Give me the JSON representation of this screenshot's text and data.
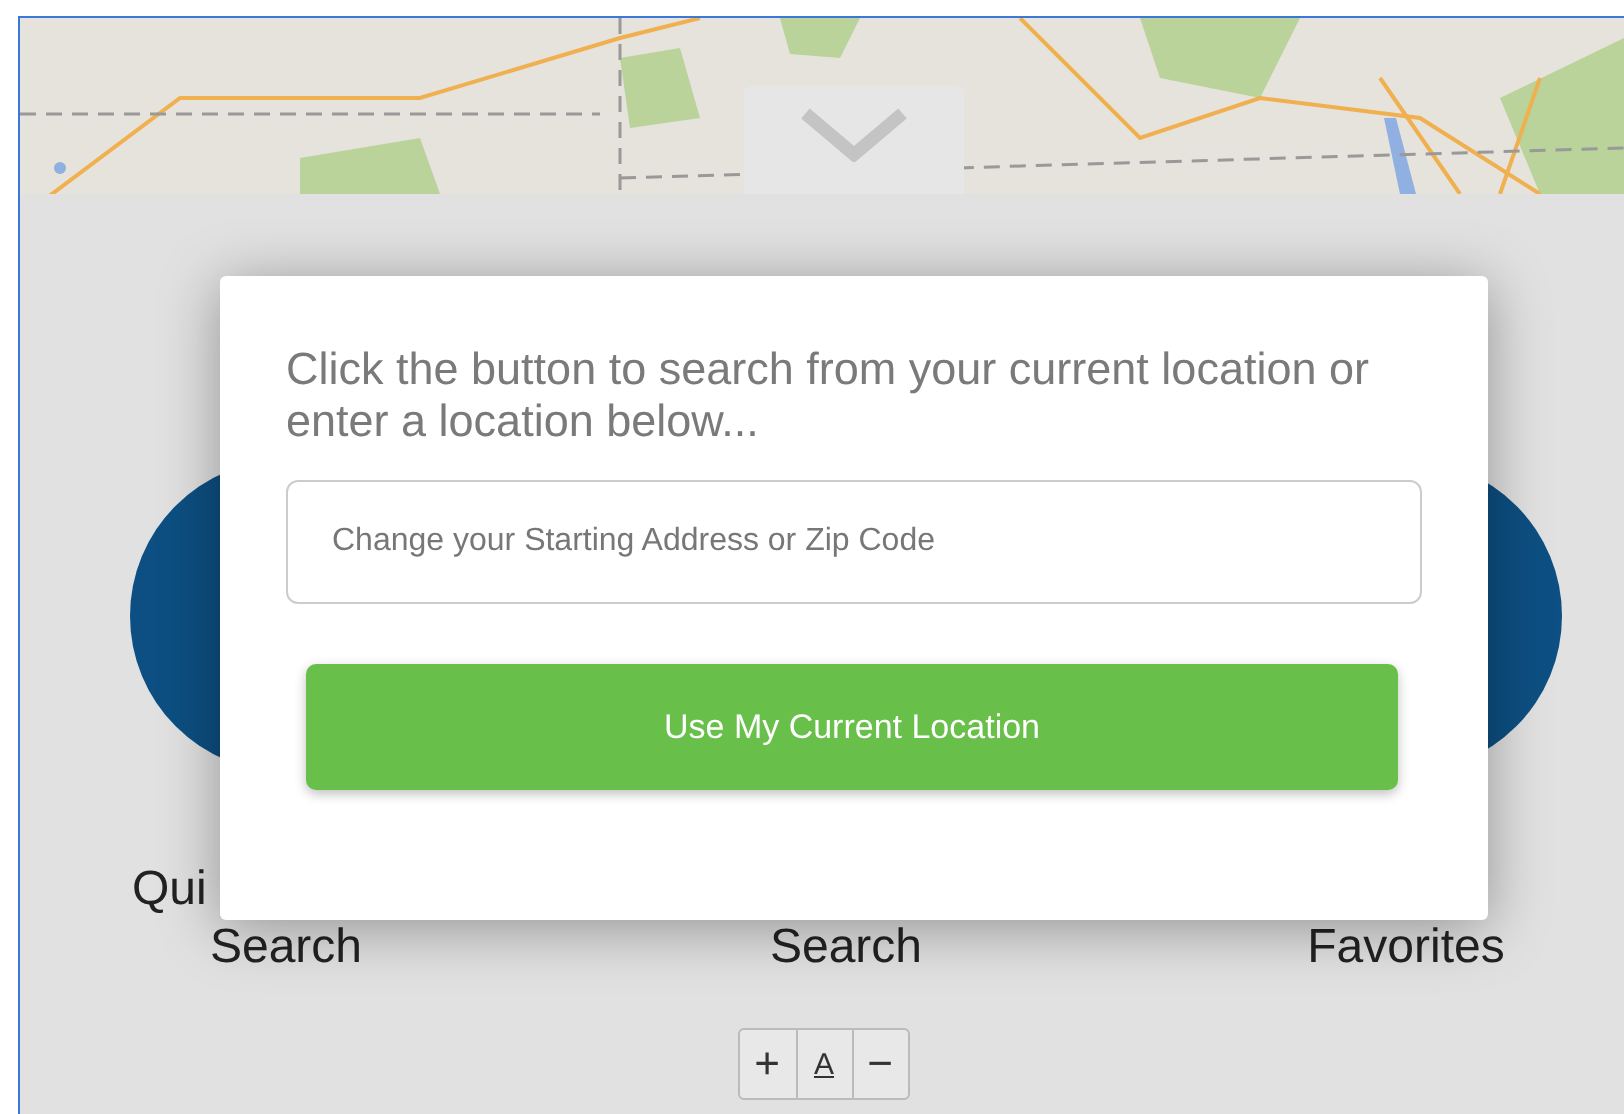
{
  "tiles": [
    {
      "label_lines": [
        "Qui",
        "Search"
      ]
    },
    {
      "label_lines": [
        "Search"
      ]
    },
    {
      "label_lines": [
        "Favorites"
      ]
    }
  ],
  "location_dialog": {
    "message": "Click the button to search from your current location or enter a location below...",
    "address_field": {
      "placeholder": "Change your Starting Address or Zip Code"
    },
    "location_button": "Use My Current Location"
  },
  "font_controls": [
    {
      "label": "+",
      "kind": "increase"
    },
    {
      "label": "A",
      "kind": "reset"
    },
    {
      "label": "−",
      "kind": "decrease"
    }
  ]
}
